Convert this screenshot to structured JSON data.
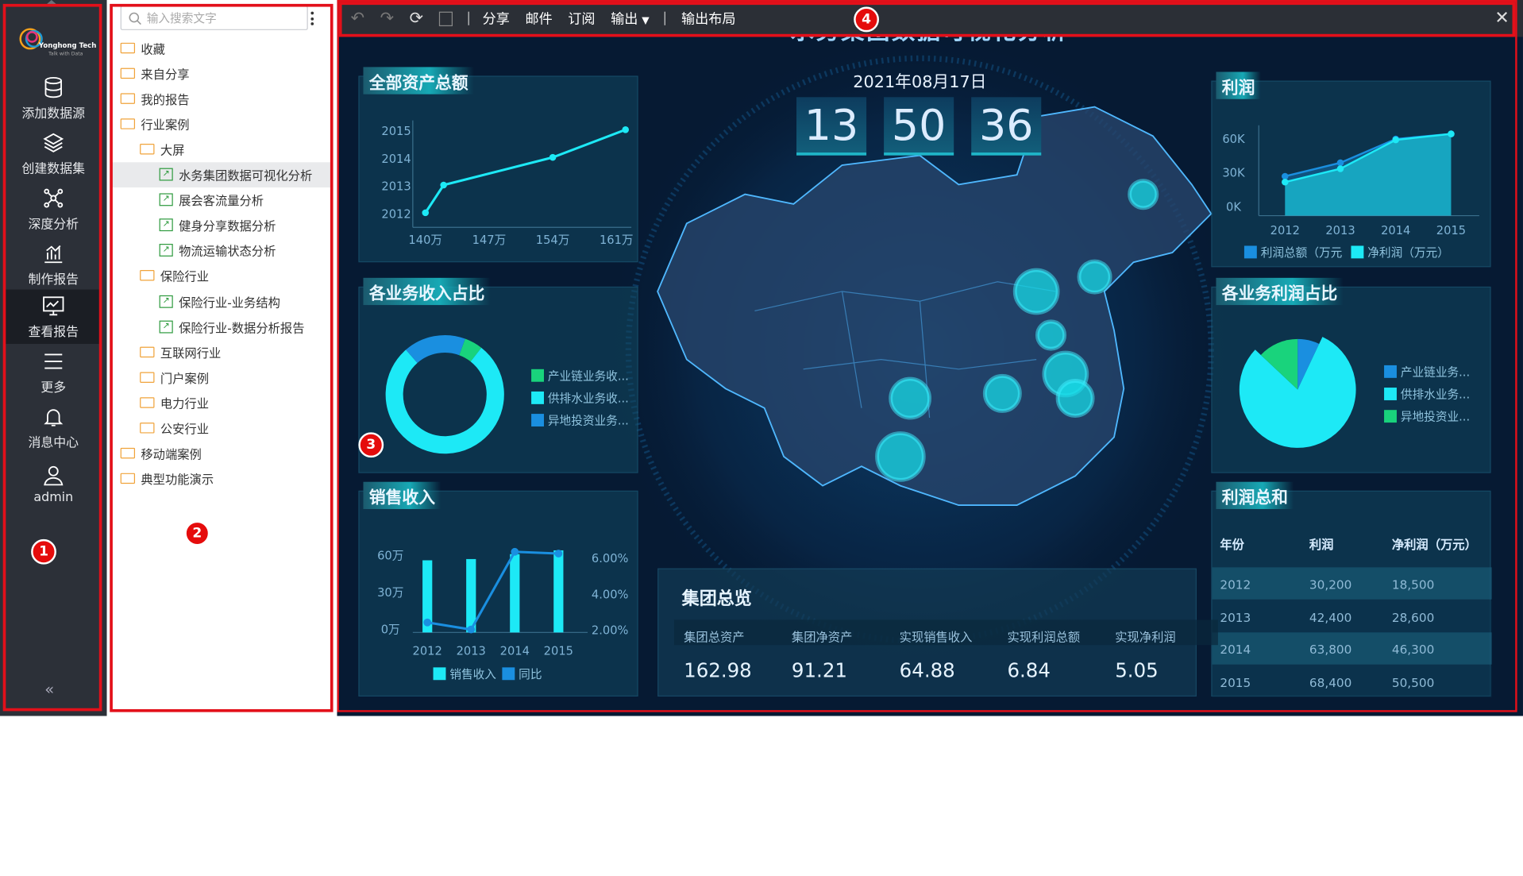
{
  "nav": {
    "logo_brand": "Yonghong Tech",
    "logo_tagline": "Talk with Data",
    "items": [
      {
        "label": "添加数据源",
        "icon": "database-icon"
      },
      {
        "label": "创建数据集",
        "icon": "layers-icon"
      },
      {
        "label": "深度分析",
        "icon": "network-icon"
      },
      {
        "label": "制作报告",
        "icon": "bar-chart-icon"
      },
      {
        "label": "查看报告",
        "icon": "monitor-chart-icon"
      },
      {
        "label": "更多",
        "icon": "menu-icon"
      },
      {
        "label": "消息中心",
        "icon": "bell-icon"
      },
      {
        "label": "admin",
        "icon": "user-icon"
      }
    ]
  },
  "tree": {
    "search_placeholder": "输入搜索文字",
    "items": [
      {
        "label": "收藏",
        "level": 0,
        "type": "folder"
      },
      {
        "label": "来自分享",
        "level": 0,
        "type": "folder"
      },
      {
        "label": "我的报告",
        "level": 0,
        "type": "folder"
      },
      {
        "label": "行业案例",
        "level": 0,
        "type": "folder"
      },
      {
        "label": "大屏",
        "level": 1,
        "type": "folder"
      },
      {
        "label": "水务集团数据可视化分析",
        "level": 2,
        "type": "report",
        "selected": true
      },
      {
        "label": "展会客流量分析",
        "level": 2,
        "type": "report"
      },
      {
        "label": "健身分享数据分析",
        "level": 2,
        "type": "report"
      },
      {
        "label": "物流运输状态分析",
        "level": 2,
        "type": "report"
      },
      {
        "label": "保险行业",
        "level": 1,
        "type": "folder"
      },
      {
        "label": "保险行业-业务结构",
        "level": 2,
        "type": "report"
      },
      {
        "label": "保险行业-数据分析报告",
        "level": 2,
        "type": "report"
      },
      {
        "label": "互联网行业",
        "level": 1,
        "type": "folder"
      },
      {
        "label": "门户案例",
        "level": 1,
        "type": "folder"
      },
      {
        "label": "电力行业",
        "level": 1,
        "type": "folder"
      },
      {
        "label": "公安行业",
        "level": 1,
        "type": "folder"
      },
      {
        "label": "移动端案例",
        "level": 0,
        "type": "folder"
      },
      {
        "label": "典型功能演示",
        "level": 0,
        "type": "folder"
      }
    ]
  },
  "toolbar": {
    "share": "分享",
    "mail": "邮件",
    "subscribe": "订阅",
    "export": "输出",
    "export_layout": "输出布局"
  },
  "dashboard": {
    "title": "水务集团数据可视化分析",
    "date": "2021年08月17日",
    "clock": [
      "13",
      "50",
      "36"
    ],
    "overview": {
      "title": "集团总览",
      "items": [
        {
          "label": "集团总资产",
          "value": "162.98"
        },
        {
          "label": "集团净资产",
          "value": "91.21"
        },
        {
          "label": "实现销售收入",
          "value": "64.88"
        },
        {
          "label": "实现利润总额",
          "value": "6.84"
        },
        {
          "label": "实现净利润",
          "value": "5.05"
        }
      ]
    },
    "profit_table": {
      "title": "利润总和",
      "headers": [
        "年份",
        "利润",
        "净利润（万元）"
      ],
      "rows": [
        [
          "2012",
          "30,200",
          "18,500"
        ],
        [
          "2013",
          "42,400",
          "28,600"
        ],
        [
          "2014",
          "63,800",
          "46,300"
        ],
        [
          "2015",
          "68,400",
          "50,500"
        ]
      ]
    }
  },
  "badges": [
    "1",
    "2",
    "3",
    "4"
  ],
  "chart_data": [
    {
      "type": "line",
      "title": "全部资产总额",
      "x": [
        "140万",
        "147万",
        "154万",
        "161万"
      ],
      "x_values": [
        140,
        147,
        154,
        161
      ],
      "points": [
        [
          140,
          2012
        ],
        [
          142,
          2013
        ],
        [
          154,
          2014
        ],
        [
          162,
          2015
        ]
      ],
      "yticks": [
        "2015",
        "2014",
        "2013",
        "2012"
      ]
    },
    {
      "type": "donut",
      "title": "各业务收入占比",
      "legend": [
        "产业链业务收...",
        "供排水业务收...",
        "异地投资业务..."
      ],
      "values": [
        5,
        78,
        17
      ],
      "colors": [
        "#19d37c",
        "#1de9f6",
        "#1a8fe0"
      ]
    },
    {
      "type": "bar",
      "title": "销售收入",
      "categories": [
        "2012",
        "2013",
        "2014",
        "2015"
      ],
      "bar_values": [
        58,
        59,
        63,
        66
      ],
      "line_values": [
        2.0,
        1.6,
        6.0,
        5.9
      ],
      "y_left": [
        "60万",
        "30万",
        "0万"
      ],
      "y_right": [
        "6.00%",
        "4.00%",
        "2.00%"
      ],
      "legend": [
        "销售收入",
        "同比"
      ]
    },
    {
      "type": "area",
      "title": "利润",
      "categories": [
        "2012",
        "2013",
        "2014",
        "2015"
      ],
      "series": [
        {
          "name": "利润总额（万元",
          "values": [
            30200,
            42400,
            63800,
            68400
          ]
        },
        {
          "name": "净利润（万元）",
          "values": [
            25000,
            37000,
            63000,
            68400
          ]
        }
      ],
      "yticks": [
        "60K",
        "30K",
        "0K"
      ]
    },
    {
      "type": "pie",
      "title": "各业务利润占比",
      "legend": [
        "产业链业务...",
        "供排水业务...",
        "异地投资业..."
      ],
      "values": [
        7,
        80,
        13
      ],
      "colors": [
        "#1a8fe0",
        "#1de9f6",
        "#19d37c"
      ]
    }
  ]
}
